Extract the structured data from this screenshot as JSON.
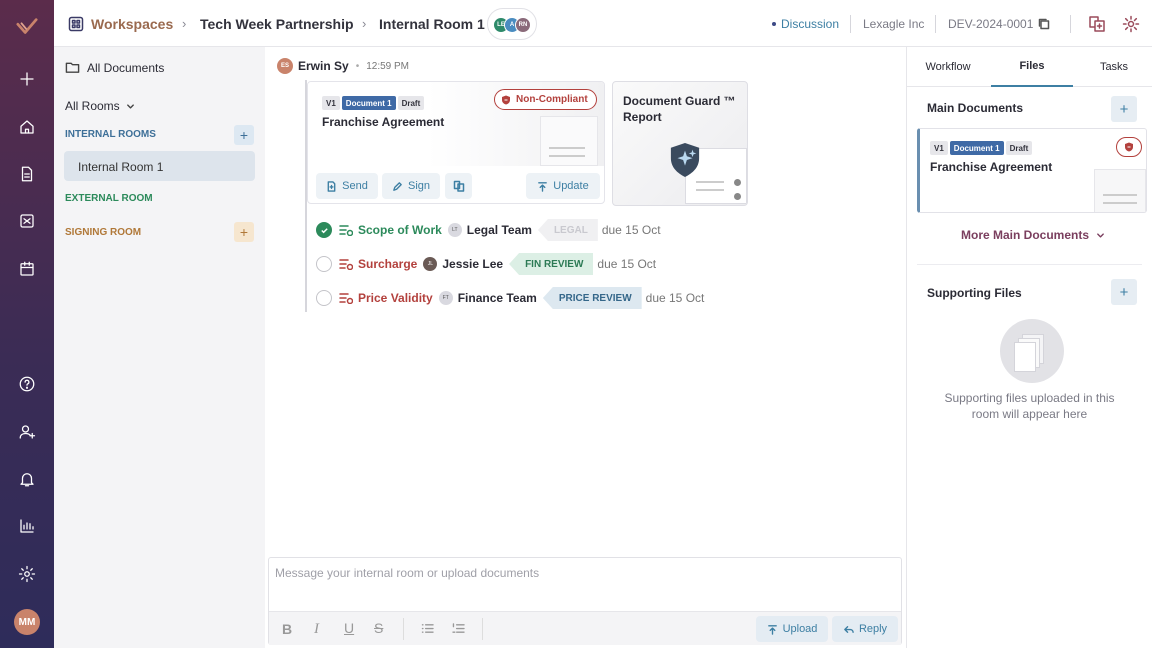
{
  "header": {
    "workspaces_label": "Workspaces",
    "breadcrumb_1": "Tech Week Partnership",
    "breadcrumb_2": "Internal Room 1",
    "members": [
      "LE",
      "A",
      "RN"
    ],
    "discussion_label": "Discussion",
    "company": "Lexagle Inc",
    "doc_id": "DEV-2024-0001"
  },
  "rail": {
    "user_initials": "MM"
  },
  "left_panel": {
    "all_documents": "All Documents",
    "all_rooms": "All Rooms",
    "internal_rooms_header": "INTERNAL ROOMS",
    "internal_room_item": "Internal Room 1",
    "external_room_header": "EXTERNAL ROOM",
    "signing_room_header": "SIGNING ROOM"
  },
  "message": {
    "author_initials": "ES",
    "author": "Erwin Sy",
    "time": "12:59 PM",
    "doc_card": {
      "version": "V1",
      "doc_tag": "Document 1",
      "status": "Draft",
      "title": "Franchise Agreement",
      "compliance": "Non-Compliant",
      "send": "Send",
      "sign": "Sign",
      "update": "Update"
    },
    "report_card": {
      "title_line1": "Document Guard ™",
      "title_line2": "Report"
    }
  },
  "tasks": [
    {
      "title": "Scope of Work",
      "assignee_initials": "LT",
      "assignee": "Legal Team",
      "stage": "LEGAL",
      "due": "due 15 Oct",
      "done": true
    },
    {
      "title": "Surcharge",
      "assignee_initials": "JL",
      "assignee": "Jessie Lee",
      "stage": "FIN REVIEW",
      "due": "due 15 Oct",
      "done": false
    },
    {
      "title": "Price Validity",
      "assignee_initials": "FT",
      "assignee": "Finance Team",
      "stage": "PRICE REVIEW",
      "due": "due 15 Oct",
      "done": false
    }
  ],
  "composer": {
    "placeholder": "Message your internal room or upload documents",
    "upload": "Upload",
    "reply": "Reply"
  },
  "right_panel": {
    "tabs": [
      "Workflow",
      "Files",
      "Tasks"
    ],
    "active_tab": "Files",
    "main_documents": "Main Documents",
    "doc": {
      "version": "V1",
      "doc_tag": "Document 1",
      "status": "Draft",
      "title": "Franchise Agreement"
    },
    "more_main_documents": "More Main Documents",
    "supporting_files": "Supporting Files",
    "empty_line1": "Supporting files uploaded in this",
    "empty_line2": "room will appear here"
  },
  "colors": {
    "accent": "#3d7fa3",
    "brand": "#9a6a4f",
    "danger": "#b3413d",
    "success": "#2c8a5b"
  }
}
